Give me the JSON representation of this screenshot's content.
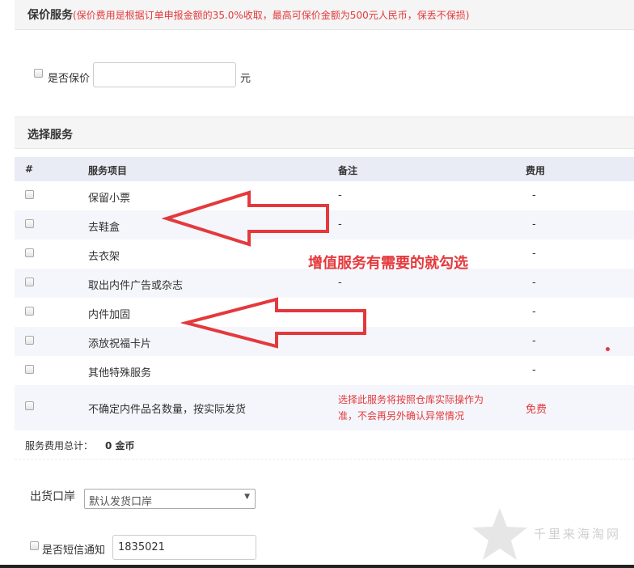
{
  "insurance": {
    "title": "保价服务",
    "note": "(保价费用是根据订单申报金额的35.0%收取，最高可保价金额为500元人民币，保丢不保损)",
    "checkbox_label": "是否保价",
    "value": "",
    "unit": "元"
  },
  "services": {
    "title": "选择服务",
    "columns": [
      "#",
      "服务项目",
      "备注",
      "费用"
    ],
    "rows": [
      {
        "name": "保留小票",
        "remark": "-",
        "fee": "-"
      },
      {
        "name": "去鞋盒",
        "remark": "-",
        "fee": "-"
      },
      {
        "name": "去衣架",
        "remark": "",
        "fee": "-"
      },
      {
        "name": "取出内件广告或杂志",
        "remark": "-",
        "fee": "-"
      },
      {
        "name": "内件加固",
        "remark": "",
        "fee": "-"
      },
      {
        "name": "添放祝福卡片",
        "remark": "",
        "fee": "-"
      },
      {
        "name": "其他特殊服务",
        "remark": "",
        "fee": "-"
      },
      {
        "name": "不确定内件品名数量，按实际发货",
        "remark_line1": "选择此服务将按照仓库实际操作为",
        "remark_line2": "准，不会再另外确认异常情况",
        "fee": "免费"
      }
    ],
    "total_label": "服务费用总计：",
    "total_value": "0 金币"
  },
  "shipping": {
    "port_label": "出货口岸",
    "port_selected": "默认发货口岸",
    "sms_label": "是否短信通知",
    "sms_value": "1835021"
  },
  "annotation": {
    "text": "增值服务有需要的就勾选",
    "color": "#e4393c"
  },
  "watermark": {
    "text": "千里来海淘网"
  },
  "icons": {
    "arrow": "left-arrow-outline-icon",
    "star": "star-watermark-icon",
    "dropdown": "chevron-down-icon"
  }
}
